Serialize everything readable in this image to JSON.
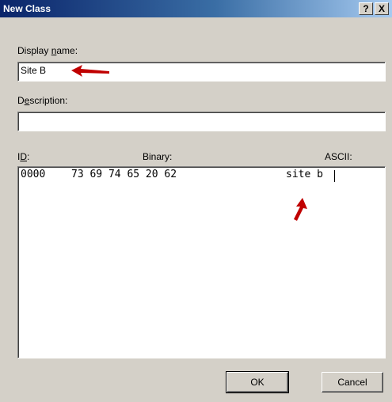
{
  "window": {
    "title": "New Class",
    "help_label": "?",
    "close_label": "X"
  },
  "display_name": {
    "label_prefix": "Display ",
    "label_mnemonic": "n",
    "label_suffix": "ame:",
    "value": "Site B"
  },
  "description": {
    "label_prefix": "D",
    "label_mnemonic": "e",
    "label_suffix": "scription:",
    "value": ""
  },
  "binary_editor": {
    "id_label_prefix": "I",
    "id_label_mnemonic": "D",
    "id_label_suffix": ":",
    "binary_label": "Binary:",
    "ascii_label": "ASCII:",
    "rows": [
      {
        "offset": "0000",
        "bytes": "73 69 74 65 20 62",
        "ascii": "site b"
      }
    ]
  },
  "buttons": {
    "ok": "OK",
    "cancel": "Cancel"
  },
  "annotations": {
    "arrow_color": "#c00000"
  }
}
